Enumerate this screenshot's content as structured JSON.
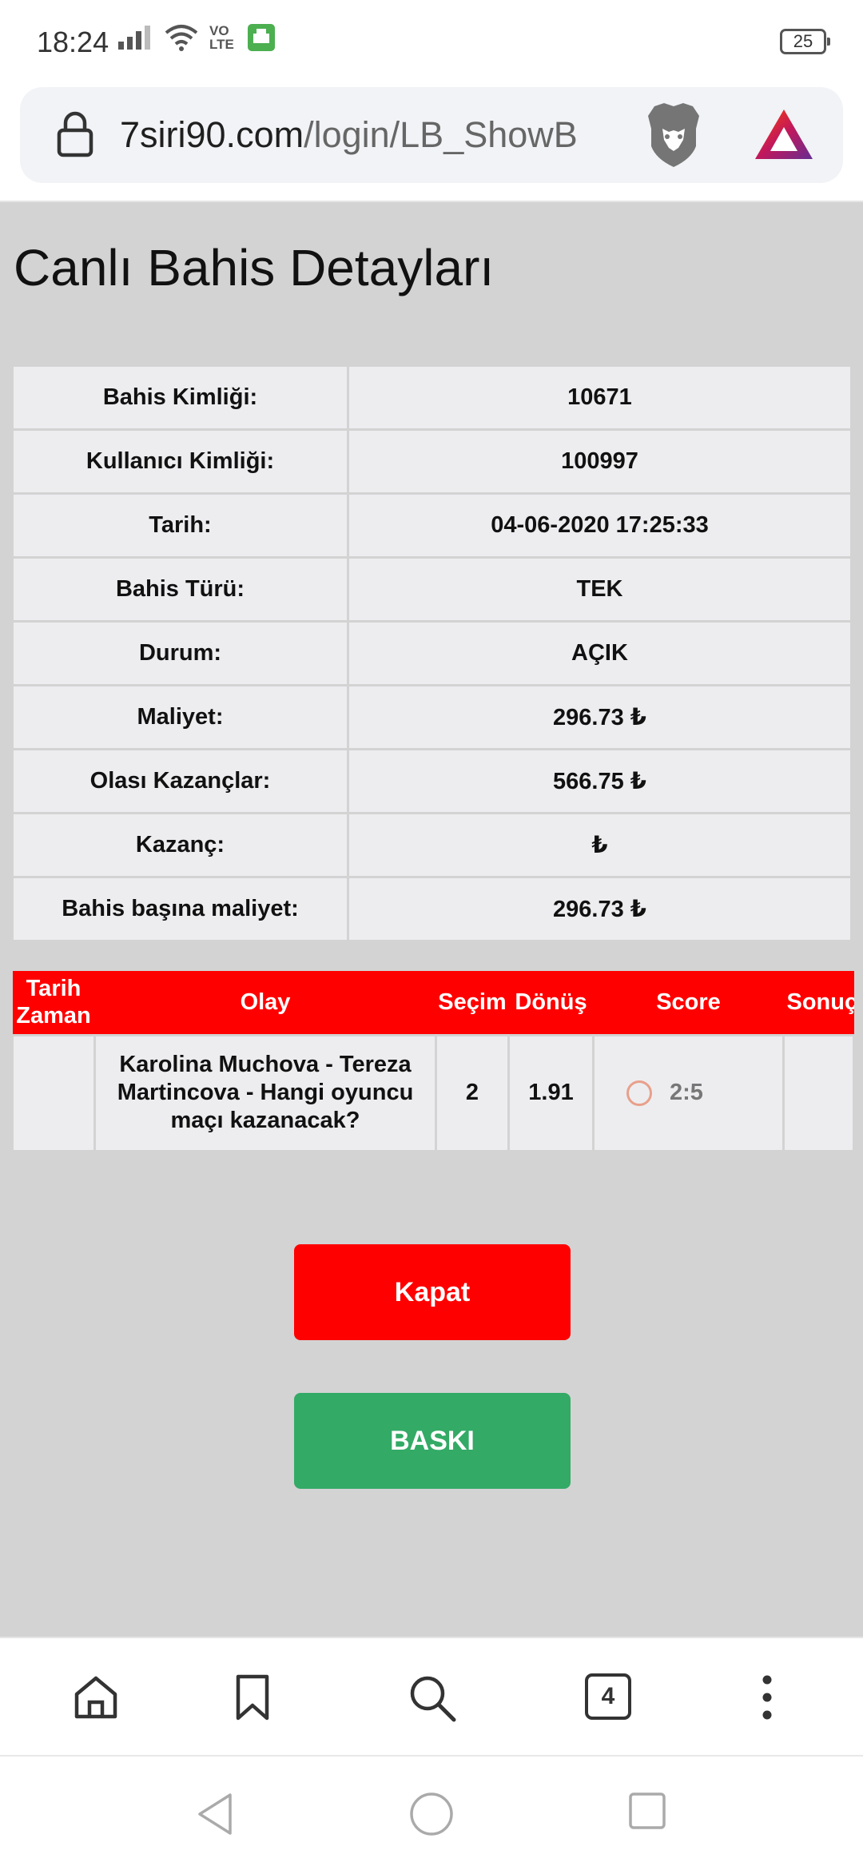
{
  "status": {
    "time": "18:24",
    "network_label": "VO\nLTE",
    "battery": "25"
  },
  "browser": {
    "url_domain": "7siri90.com",
    "url_path": "/login/LB_ShowB",
    "tab_count": "4"
  },
  "page": {
    "title": "Canlı Bahis Detayları",
    "details": [
      {
        "label": "Bahis Kimliği:",
        "value": "10671"
      },
      {
        "label": "Kullanıcı Kimliği:",
        "value": "100997"
      },
      {
        "label": "Tarih:",
        "value": "04-06-2020 17:25:33"
      },
      {
        "label": "Bahis Türü:",
        "value": "TEK"
      },
      {
        "label": "Durum:",
        "value": "AÇIK"
      },
      {
        "label": "Maliyet:",
        "value": "296.73 ₺"
      },
      {
        "label": "Olası Kazançlar:",
        "value": "566.75 ₺"
      },
      {
        "label": "Kazanç:",
        "value": "₺"
      },
      {
        "label": "Bahis başına maliyet:",
        "value": "296.73 ₺"
      }
    ],
    "bets_table": {
      "headers": {
        "date_line1": "Tarih",
        "date_line2": "Zaman",
        "event": "Olay",
        "selection": "Seçim",
        "return": "Dönüş",
        "score": "Score",
        "result": "Sonuç"
      },
      "rows": [
        {
          "date": "",
          "event": "Karolina Muchova - Tereza Martincova - Hangi oyuncu maçı kazanacak?",
          "selection": "2",
          "return": "1.91",
          "score": "2:5",
          "result": ""
        }
      ]
    },
    "buttons": {
      "close": "Kapat",
      "print": "BASKI"
    }
  },
  "colors": {
    "accent_red": "#ff0000",
    "print_green": "#33aa66",
    "page_bg": "#d3d3d3"
  }
}
